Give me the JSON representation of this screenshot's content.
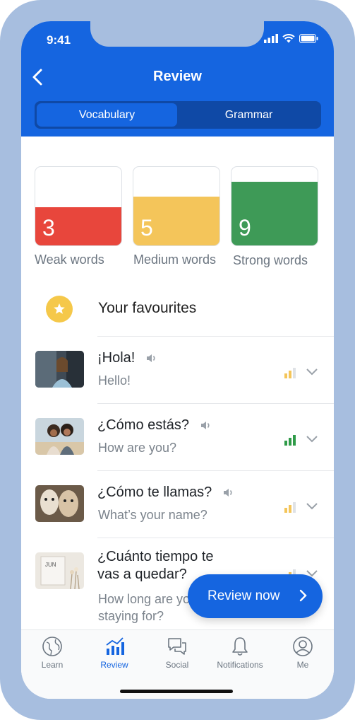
{
  "status_bar": {
    "time": "9:41"
  },
  "header": {
    "title": "Review",
    "tabs": [
      {
        "label": "Vocabulary",
        "active": true
      },
      {
        "label": "Grammar",
        "active": false
      }
    ]
  },
  "word_strength": [
    {
      "count": "3",
      "label": "Weak words",
      "color": "#e8463c",
      "fill_fraction": 0.48
    },
    {
      "count": "5",
      "label": "Medium words",
      "color": "#f4c55a",
      "fill_fraction": 0.61
    },
    {
      "count": "9",
      "label": "Strong words",
      "color": "#3e9a57",
      "fill_fraction": 0.8
    }
  ],
  "favourites": {
    "label": "Your favourites",
    "icon": "star-icon"
  },
  "phrases": [
    {
      "spanish": "¡Hola!",
      "english": "Hello!",
      "strength": 2,
      "strength_color": "#f4c55a"
    },
    {
      "spanish": "¿Cómo estás?",
      "english": "How are you?",
      "strength": 3,
      "strength_color": "#2f9b48"
    },
    {
      "spanish": "¿Cómo te llamas?",
      "english": "What’s your name?",
      "strength": 2,
      "strength_color": "#f4c55a"
    },
    {
      "spanish_line1": "¿Cuánto tiempo te",
      "spanish_line2": "vas a quedar?",
      "english_line1": "How long are you",
      "english_line2": "staying for?",
      "strength": 2,
      "strength_color": "#f4c55a"
    }
  ],
  "review_button": {
    "label": "Review now"
  },
  "nav": [
    {
      "label": "Learn",
      "icon": "globe-icon"
    },
    {
      "label": "Review",
      "icon": "bar-chart-icon",
      "active": true
    },
    {
      "label": "Social",
      "icon": "chat-icon"
    },
    {
      "label": "Notifications",
      "icon": "bell-icon"
    },
    {
      "label": "Me",
      "icon": "profile-icon"
    }
  ],
  "colors": {
    "primary": "#1565e0",
    "primary_dark": "#0f49a6",
    "frame": "#a7bedf"
  }
}
